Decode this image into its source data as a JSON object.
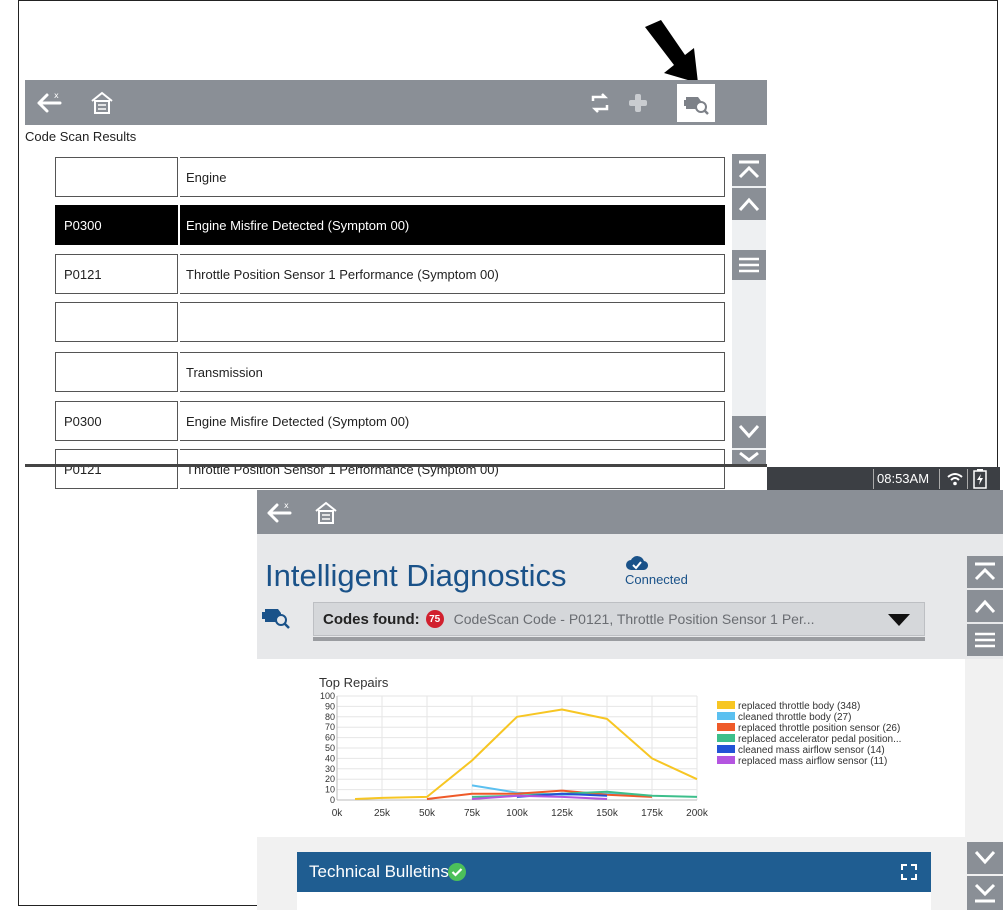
{
  "screen1": {
    "title": "Code Scan Results",
    "rows": [
      {
        "code": "",
        "description": "Engine",
        "selected": false
      },
      {
        "code": "P0300",
        "description": "Engine Misfire Detected (Symptom 00)",
        "selected": true
      },
      {
        "code": "P0121",
        "description": "Throttle Position Sensor 1 Performance (Symptom 00)",
        "selected": false
      },
      {
        "code": "",
        "description": "",
        "selected": false
      },
      {
        "code": "",
        "description": "Transmission",
        "selected": false
      },
      {
        "code": "P0300",
        "description": "Engine Misfire Detected (Symptom 00)",
        "selected": false
      },
      {
        "code": "P0121",
        "description": "Throttle Position Sensor 1 Performance (Symptom 00)",
        "selected": false
      }
    ]
  },
  "status_bar": {
    "time": "08:53AM"
  },
  "screen2": {
    "title": "Intelligent Diagnostics",
    "connection_status": "Connected",
    "codes_found_label": "Codes found:",
    "codes_count": "75",
    "codes_value": "CodeScan Code - P0121, Throttle Position Sensor 1 Per...",
    "technical_bulletins_title": "Technical Bulletins"
  },
  "chart_data": {
    "type": "line",
    "title": "Top Repairs",
    "x": [
      0,
      25,
      50,
      75,
      100,
      125,
      150,
      175,
      200
    ],
    "x_tick_labels": [
      "0k",
      "25k",
      "50k",
      "75k",
      "100k",
      "125k",
      "150k",
      "175k",
      "200k"
    ],
    "y_tick_labels": [
      "100",
      "90",
      "80",
      "70",
      "60",
      "50",
      "40",
      "30",
      "20",
      "10",
      "0"
    ],
    "ylim": [
      0,
      100
    ],
    "xlim": [
      0,
      200
    ],
    "grid": true,
    "legend_position": "right",
    "series": [
      {
        "name": "replaced throttle body (348)",
        "color": "#f7c623",
        "points": [
          [
            10,
            1
          ],
          [
            25,
            2
          ],
          [
            50,
            3
          ],
          [
            75,
            38
          ],
          [
            100,
            80
          ],
          [
            125,
            87
          ],
          [
            150,
            78
          ],
          [
            175,
            40
          ],
          [
            200,
            20
          ]
        ]
      },
      {
        "name": "cleaned throttle body (27)",
        "color": "#5bc0f0",
        "points": [
          [
            75,
            14
          ],
          [
            100,
            7
          ],
          [
            125,
            5
          ],
          [
            150,
            6
          ],
          [
            175,
            4
          ]
        ]
      },
      {
        "name": "replaced throttle position sensor (26)",
        "color": "#ef5a29",
        "points": [
          [
            50,
            1
          ],
          [
            75,
            6
          ],
          [
            100,
            6
          ],
          [
            125,
            9
          ],
          [
            150,
            5
          ],
          [
            175,
            3
          ]
        ]
      },
      {
        "name": "replaced accelerator pedal position...",
        "color": "#3dbf8b",
        "points": [
          [
            75,
            3
          ],
          [
            100,
            4
          ],
          [
            125,
            6
          ],
          [
            150,
            8
          ],
          [
            175,
            4
          ],
          [
            200,
            3
          ]
        ]
      },
      {
        "name": "cleaned mass airflow sensor (14)",
        "color": "#2253d6",
        "points": [
          [
            100,
            3
          ],
          [
            125,
            6
          ],
          [
            150,
            4
          ]
        ]
      },
      {
        "name": "replaced mass airflow sensor (11)",
        "color": "#b455e0",
        "points": [
          [
            75,
            1
          ],
          [
            100,
            4
          ],
          [
            125,
            3
          ],
          [
            150,
            1
          ]
        ]
      }
    ]
  }
}
